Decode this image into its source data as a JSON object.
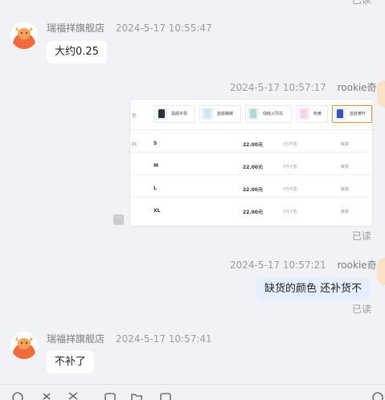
{
  "top_read": "已读",
  "messages": [
    {
      "sender": "瑞福祥旗舰店",
      "time": "2024-5-17 10:55:47",
      "text": "大约0.25"
    },
    {
      "sender": "rookie奇",
      "time": "2024-5-17 10:57:17",
      "read": "已读",
      "image": {
        "color_label": "色",
        "size_label": "码",
        "colors": [
          "黑底字母",
          "蓝底蝴蝶",
          "绿底火烈鸟",
          "粉黄",
          "蓝底黄叶"
        ],
        "rows": [
          {
            "size": "S",
            "price": "22.00元",
            "stock": "0件可售",
            "status": "缺货"
          },
          {
            "size": "M",
            "price": "22.00元",
            "stock": "0件可售",
            "status": "缺货"
          },
          {
            "size": "L",
            "price": "22.00元",
            "stock": "0件可售",
            "status": "缺货"
          },
          {
            "size": "XL",
            "price": "22.00元",
            "stock": "0件可售",
            "status": "缺货"
          }
        ]
      }
    },
    {
      "sender": "rookie奇",
      "time": "2024-5-17 10:57:21",
      "text": "缺货的颜色 还补货不",
      "read": "已读"
    },
    {
      "sender": "瑞福祥旗舰店",
      "time": "2024-5-17 10:57:41",
      "text": "不补了"
    }
  ],
  "more_icon": "ellipsis-icon",
  "colors": {
    "background": "#f1f2f6",
    "my_bubble": "#e6efff",
    "accent": "#f08b3b"
  }
}
